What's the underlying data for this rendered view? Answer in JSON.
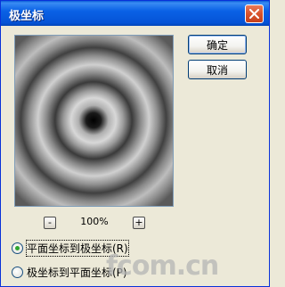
{
  "window": {
    "title": "极坐标",
    "close_icon": "close-icon"
  },
  "buttons": {
    "ok_label": "确定",
    "cancel_label": "取消"
  },
  "preview": {
    "description": "concentric-rings"
  },
  "zoom": {
    "minus_label": "-",
    "plus_label": "+",
    "level": "100%"
  },
  "options": [
    {
      "label": "平面坐标到极坐标(R)",
      "selected": true
    },
    {
      "label": "极坐标到平面坐标(P)",
      "selected": false
    }
  ],
  "watermark": {
    "text": "fcom.cn"
  },
  "colors": {
    "titlebar": "#0a62e6",
    "dialog_bg": "#ece9d8",
    "radio_check": "#2fa62f"
  }
}
